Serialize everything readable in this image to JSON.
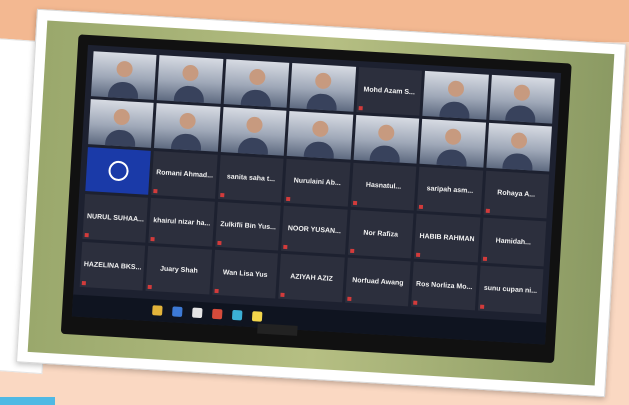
{
  "colors": {
    "background": "#f6c9aa",
    "screen": "#1d2130",
    "tile": "#2c2f3d",
    "accent": "#1a3aa8"
  },
  "tiles": [
    {
      "type": "video",
      "name": ""
    },
    {
      "type": "video",
      "name": ""
    },
    {
      "type": "video",
      "name": ""
    },
    {
      "type": "video",
      "name": ""
    },
    {
      "type": "text",
      "name": "Mohd Azam S..."
    },
    {
      "type": "video",
      "name": ""
    },
    {
      "type": "video",
      "name": ""
    },
    {
      "type": "video",
      "name": ""
    },
    {
      "type": "video",
      "name": ""
    },
    {
      "type": "video",
      "name": ""
    },
    {
      "type": "video",
      "name": ""
    },
    {
      "type": "video",
      "name": ""
    },
    {
      "type": "video",
      "name": ""
    },
    {
      "type": "video",
      "name": ""
    },
    {
      "type": "logo",
      "name": ""
    },
    {
      "type": "text",
      "name": "Romani Ahmad..."
    },
    {
      "type": "text",
      "name": "sanita saha t..."
    },
    {
      "type": "text",
      "name": "Nurulaini Ab..."
    },
    {
      "type": "text",
      "name": "Hasnatul..."
    },
    {
      "type": "text",
      "name": "saripah asm..."
    },
    {
      "type": "text",
      "name": "Rohaya A..."
    },
    {
      "type": "text",
      "name": "NURUL SUHAA..."
    },
    {
      "type": "text",
      "name": "khairul nizar ha..."
    },
    {
      "type": "text",
      "name": "Zulkifli Bin Yus..."
    },
    {
      "type": "text",
      "name": "NOOR YUSAN..."
    },
    {
      "type": "text",
      "name": "Nor Rafiza"
    },
    {
      "type": "text",
      "name": "HABIB RAHMAN"
    },
    {
      "type": "text",
      "name": "Hamidah..."
    },
    {
      "type": "text",
      "name": "HAZELINA BKS..."
    },
    {
      "type": "text",
      "name": "Juary Shah"
    },
    {
      "type": "text",
      "name": "Wan Lisa Yus"
    },
    {
      "type": "text",
      "name": "AZIYAH AZIZ"
    },
    {
      "type": "text",
      "name": "Norfuad Awang"
    },
    {
      "type": "text",
      "name": "Ros Norliza Mo..."
    },
    {
      "type": "text",
      "name": "sunu cupan ni..."
    }
  ],
  "taskbar_icons": [
    "#e2b33a",
    "#3d7ad6",
    "#e5e5e5",
    "#d64b3b",
    "#3bb0d6",
    "#f3d64b"
  ]
}
